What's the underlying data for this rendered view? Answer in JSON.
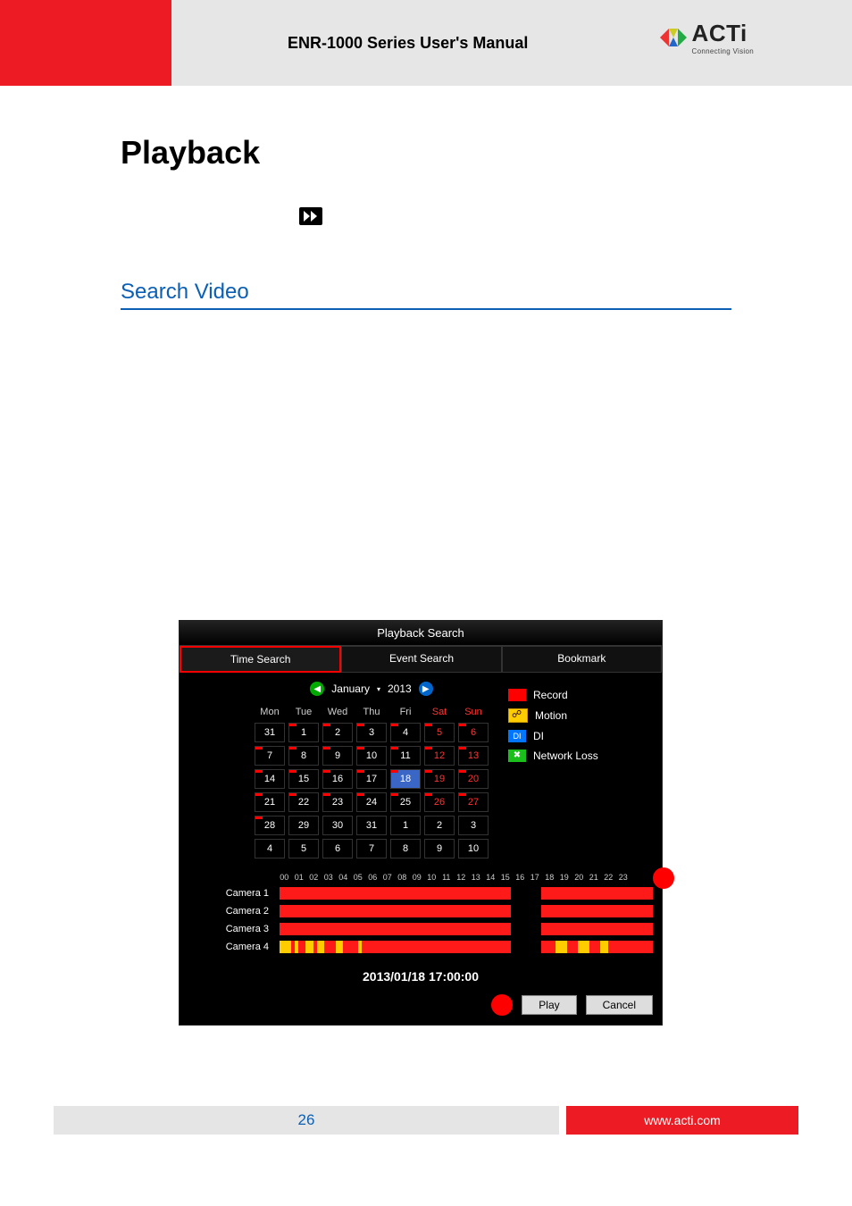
{
  "header": {
    "title": "ENR-1000 Series User's Manual",
    "brand": "ACTi",
    "tagline": "Connecting Vision"
  },
  "page": {
    "h1": "Playback",
    "h2": "Search Video",
    "number": "26",
    "footer_url": "www.acti.com"
  },
  "panel": {
    "title": "Playback Search",
    "tabs": {
      "time": "Time Search",
      "event": "Event Search",
      "bookmark": "Bookmark"
    },
    "month": "January",
    "year": "2013",
    "dow": [
      "Mon",
      "Tue",
      "Wed",
      "Thu",
      "Fri",
      "Sat",
      "Sun"
    ],
    "weeks": [
      [
        {
          "d": "31"
        },
        {
          "d": "1",
          "r": 1
        },
        {
          "d": "2",
          "r": 1
        },
        {
          "d": "3",
          "r": 1
        },
        {
          "d": "4",
          "r": 1
        },
        {
          "d": "5",
          "r": 1,
          "w": 1
        },
        {
          "d": "6",
          "r": 1,
          "w": 1
        }
      ],
      [
        {
          "d": "7",
          "r": 1
        },
        {
          "d": "8",
          "r": 1
        },
        {
          "d": "9",
          "r": 1
        },
        {
          "d": "10",
          "r": 1
        },
        {
          "d": "11",
          "r": 1
        },
        {
          "d": "12",
          "r": 1,
          "w": 1
        },
        {
          "d": "13",
          "r": 1,
          "w": 1
        }
      ],
      [
        {
          "d": "14",
          "r": 1
        },
        {
          "d": "15",
          "r": 1
        },
        {
          "d": "16",
          "r": 1
        },
        {
          "d": "17",
          "r": 1
        },
        {
          "d": "18",
          "r": 1,
          "s": 1
        },
        {
          "d": "19",
          "r": 1,
          "w": 1
        },
        {
          "d": "20",
          "r": 1,
          "w": 1
        }
      ],
      [
        {
          "d": "21",
          "r": 1
        },
        {
          "d": "22",
          "r": 1
        },
        {
          "d": "23",
          "r": 1
        },
        {
          "d": "24",
          "r": 1
        },
        {
          "d": "25",
          "r": 1
        },
        {
          "d": "26",
          "r": 1,
          "w": 1
        },
        {
          "d": "27",
          "r": 1,
          "w": 1
        }
      ],
      [
        {
          "d": "28",
          "r": 1
        },
        {
          "d": "29"
        },
        {
          "d": "30"
        },
        {
          "d": "31"
        },
        {
          "d": "1"
        },
        {
          "d": "2"
        },
        {
          "d": "3"
        }
      ],
      [
        {
          "d": "4"
        },
        {
          "d": "5"
        },
        {
          "d": "6"
        },
        {
          "d": "7"
        },
        {
          "d": "8"
        },
        {
          "d": "9"
        },
        {
          "d": "10"
        }
      ]
    ],
    "legend": {
      "record": "Record",
      "motion": "Motion",
      "di": "DI",
      "nl": "Network Loss"
    },
    "hours": [
      "00",
      "01",
      "02",
      "03",
      "04",
      "05",
      "06",
      "07",
      "08",
      "09",
      "10",
      "11",
      "12",
      "13",
      "14",
      "15",
      "16",
      "17",
      "18",
      "19",
      "20",
      "21",
      "22",
      "23"
    ],
    "cameras": [
      "Camera 1",
      "Camera 2",
      "Camera 3",
      "Camera 4"
    ],
    "timestamp": "2013/01/18 17:00:00",
    "buttons": {
      "play": "Play",
      "cancel": "Cancel"
    }
  }
}
